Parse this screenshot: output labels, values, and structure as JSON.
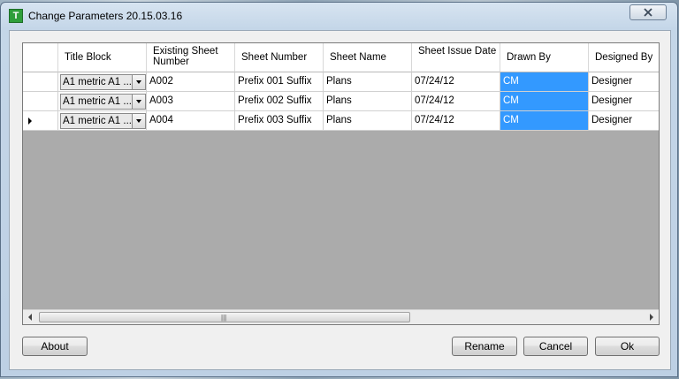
{
  "window": {
    "title": "Change Parameters 20.15.03.16",
    "icon_letter": "T"
  },
  "grid": {
    "columns": [
      {
        "label": "Title Block"
      },
      {
        "label": "Existing Sheet Number"
      },
      {
        "label": "Sheet Number"
      },
      {
        "label": "Sheet Name"
      },
      {
        "label": "Sheet Issue Date"
      },
      {
        "label": "Drawn By"
      },
      {
        "label": "Designed By"
      }
    ],
    "rows": [
      {
        "title_block": "A1 metric A1 ...",
        "existing": "A002",
        "sheet_number": "Prefix 001 Suffix",
        "sheet_name": "Plans",
        "date": "07/24/12",
        "drawn_by": "CM",
        "designed_by": "Designer"
      },
      {
        "title_block": "A1 metric A1 ...",
        "existing": "A003",
        "sheet_number": "Prefix 002 Suffix",
        "sheet_name": "Plans",
        "date": "07/24/12",
        "drawn_by": "CM",
        "designed_by": "Designer"
      },
      {
        "title_block": "A1 metric A1 ...",
        "existing": "A004",
        "sheet_number": "Prefix 003 Suffix",
        "sheet_name": "Plans",
        "date": "07/24/12",
        "drawn_by": "CM",
        "designed_by": "Designer"
      }
    ]
  },
  "buttons": {
    "about": "About",
    "rename": "Rename",
    "cancel": "Cancel",
    "ok": "Ok"
  },
  "colors": {
    "selection": "#3399ff",
    "grid_empty": "#ababab"
  }
}
